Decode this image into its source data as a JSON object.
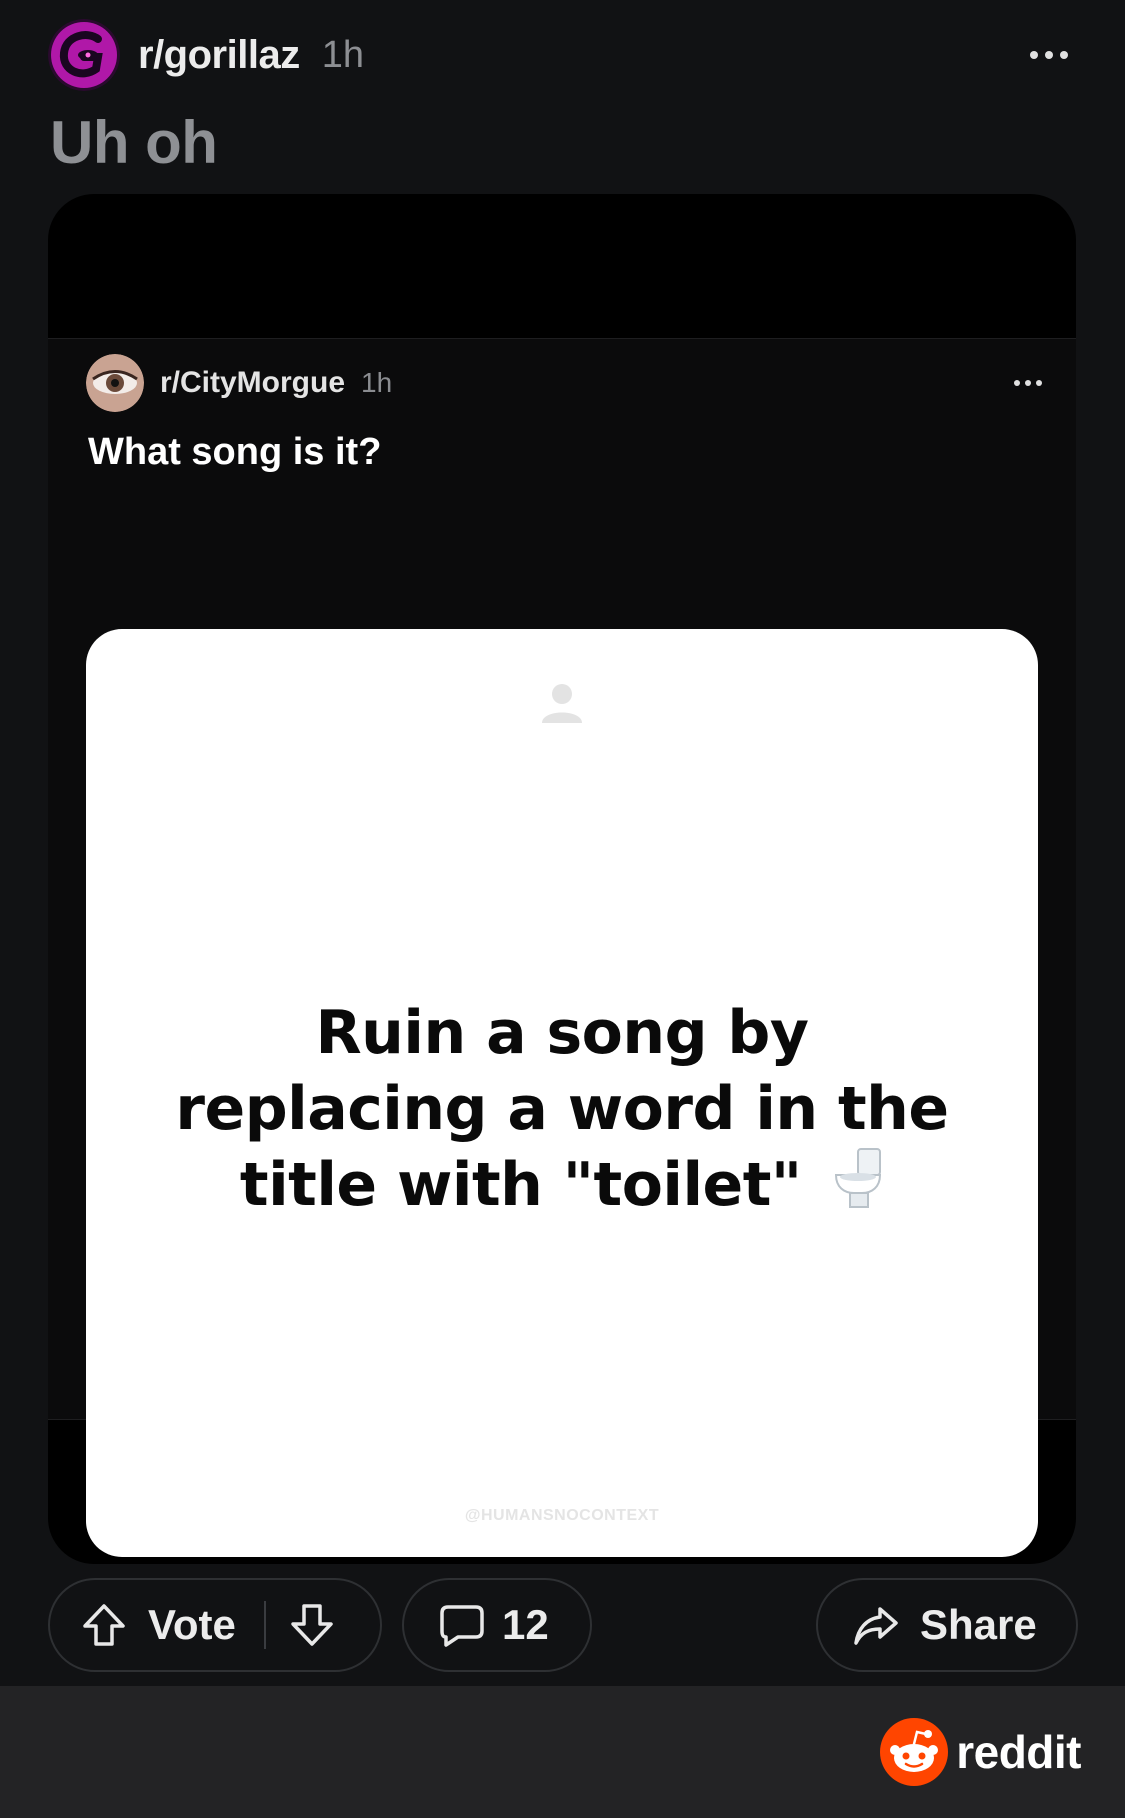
{
  "post": {
    "subreddit": "r/gorillaz",
    "time": "1h",
    "title": "Uh oh"
  },
  "embed": {
    "subreddit": "r/CityMorgue",
    "time": "1h",
    "title": "What song is it?",
    "image_text": "Ruin a song by replacing a word in the title with \"toilet\"",
    "watermark": "@HUMANSNOCONTEXT"
  },
  "actions": {
    "vote_label": "Vote",
    "comment_count": "12",
    "share_label": "Share"
  },
  "footer": {
    "brand": "reddit"
  },
  "colors": {
    "background": "#111214",
    "accent": "#ff4500",
    "gorillaz_avatar": "#c21bb0"
  },
  "icons": [
    "more-icon",
    "upvote-icon",
    "downvote-icon",
    "comment-icon",
    "share-icon",
    "snoo-logo",
    "person-icon",
    "toilet-icon"
  ]
}
